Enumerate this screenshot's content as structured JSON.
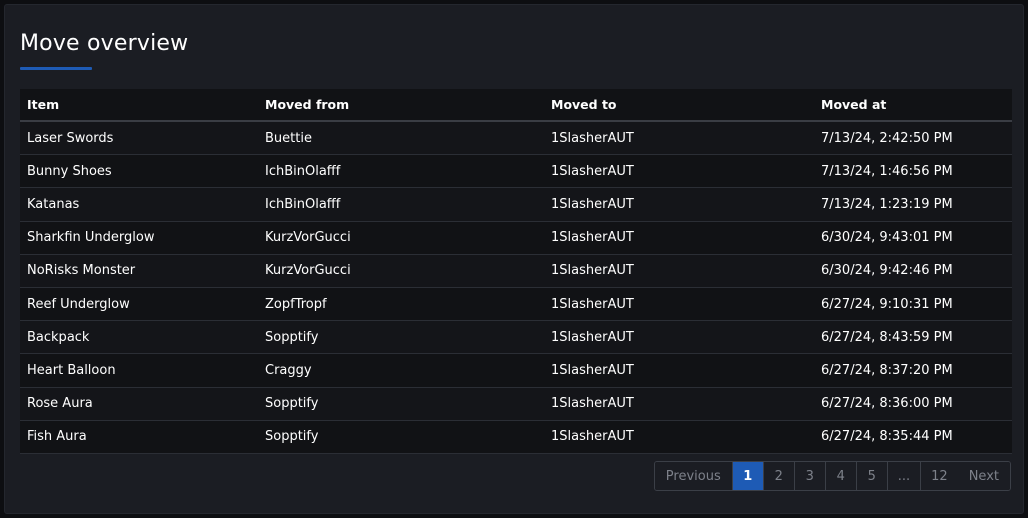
{
  "header": {
    "title": "Move overview"
  },
  "table": {
    "columns": [
      "Item",
      "Moved from",
      "Moved to",
      "Moved at"
    ],
    "rows": [
      [
        "Laser Swords",
        "Buettie",
        "1SlasherAUT",
        "7/13/24, 2:42:50 PM"
      ],
      [
        "Bunny Shoes",
        "IchBinOlafff",
        "1SlasherAUT",
        "7/13/24, 1:46:56 PM"
      ],
      [
        "Katanas",
        "IchBinOlafff",
        "1SlasherAUT",
        "7/13/24, 1:23:19 PM"
      ],
      [
        "Sharkfin Underglow",
        "KurzVorGucci",
        "1SlasherAUT",
        "6/30/24, 9:43:01 PM"
      ],
      [
        "NoRisks Monster",
        "KurzVorGucci",
        "1SlasherAUT",
        "6/30/24, 9:42:46 PM"
      ],
      [
        "Reef Underglow",
        "ZopfTropf",
        "1SlasherAUT",
        "6/27/24, 9:10:31 PM"
      ],
      [
        "Backpack",
        "Sopptify",
        "1SlasherAUT",
        "6/27/24, 8:43:59 PM"
      ],
      [
        "Heart Balloon",
        "Craggy",
        "1SlasherAUT",
        "6/27/24, 8:37:20 PM"
      ],
      [
        "Rose Aura",
        "Sopptify",
        "1SlasherAUT",
        "6/27/24, 8:36:00 PM"
      ],
      [
        "Fish Aura",
        "Sopptify",
        "1SlasherAUT",
        "6/27/24, 8:35:44 PM"
      ]
    ]
  },
  "pagination": {
    "previous": "Previous",
    "pages": [
      "1",
      "2",
      "3",
      "4",
      "5",
      "...",
      "12"
    ],
    "active": "1",
    "next": "Next"
  },
  "colors": {
    "accent": "#1e5bb5",
    "background": "#1b1d23",
    "row": "#111215"
  }
}
